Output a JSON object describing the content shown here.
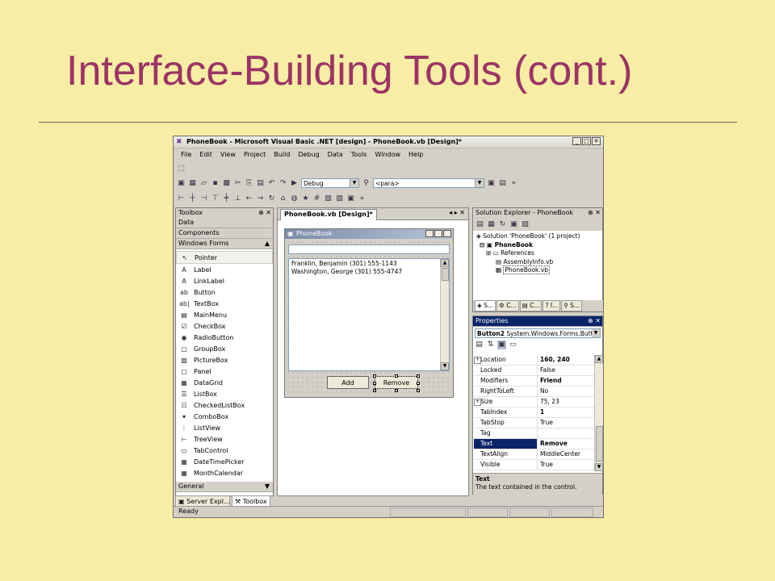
{
  "slide": {
    "title": "Interface-Building Tools (cont.)",
    "title_color": "#9b3464",
    "background": "#f7eda5"
  },
  "window": {
    "title": "PhoneBook - Microsoft Visual Basic .NET [design] - PhoneBook.vb [Design]*",
    "menu": [
      "File",
      "Edit",
      "View",
      "Project",
      "Build",
      "Debug",
      "Data",
      "Tools",
      "Window",
      "Help"
    ],
    "config_combo": "Debug",
    "find_combo": "<para>"
  },
  "toolbox": {
    "title": "Toolbox",
    "sections": [
      "Data",
      "Components",
      "Windows Forms"
    ],
    "items": [
      {
        "label": "Pointer",
        "icon": "pointer-icon",
        "glyph": "↖"
      },
      {
        "label": "Label",
        "icon": "label-icon",
        "glyph": "A"
      },
      {
        "label": "LinkLabel",
        "icon": "linklabel-icon",
        "glyph": "A"
      },
      {
        "label": "Button",
        "icon": "button-icon",
        "glyph": "ab"
      },
      {
        "label": "TextBox",
        "icon": "textbox-icon",
        "glyph": "ab|"
      },
      {
        "label": "MainMenu",
        "icon": "mainmenu-icon",
        "glyph": "▤"
      },
      {
        "label": "CheckBox",
        "icon": "checkbox-icon",
        "glyph": "☑"
      },
      {
        "label": "RadioButton",
        "icon": "radiobutton-icon",
        "glyph": "◉"
      },
      {
        "label": "GroupBox",
        "icon": "groupbox-icon",
        "glyph": "▢"
      },
      {
        "label": "PictureBox",
        "icon": "picturebox-icon",
        "glyph": "▨"
      },
      {
        "label": "Panel",
        "icon": "panel-icon",
        "glyph": "□"
      },
      {
        "label": "DataGrid",
        "icon": "datagrid-icon",
        "glyph": "▦"
      },
      {
        "label": "ListBox",
        "icon": "listbox-icon",
        "glyph": "☰"
      },
      {
        "label": "CheckedListBox",
        "icon": "checkedlistbox-icon",
        "glyph": "☷"
      },
      {
        "label": "ComboBox",
        "icon": "combobox-icon",
        "glyph": "▾"
      },
      {
        "label": "ListView",
        "icon": "listview-icon",
        "glyph": "⋮"
      },
      {
        "label": "TreeView",
        "icon": "treeview-icon",
        "glyph": "⊢"
      },
      {
        "label": "TabControl",
        "icon": "tabcontrol-icon",
        "glyph": "▭"
      },
      {
        "label": "DateTimePicker",
        "icon": "datetimepicker-icon",
        "glyph": "▦"
      },
      {
        "label": "MonthCalendar",
        "icon": "monthcalendar-icon",
        "glyph": "▦"
      }
    ],
    "footer_section": "General",
    "bottom_tabs": [
      "Server Expl...",
      "Toolbox"
    ]
  },
  "designer": {
    "tab": "PhoneBook.vb [Design]*",
    "form_title": "PhoneBook",
    "list_items": [
      "Franklin, Benjamin (301) 555-1143",
      "Washington, George (301) 555-4747"
    ],
    "add_button": "Add",
    "remove_button": "Remove"
  },
  "solution_explorer": {
    "title": "Solution Explorer - PhoneBook",
    "solution": "Solution 'PhoneBook' (1 project)",
    "project": "PhoneBook",
    "items": [
      "References",
      "AssemblyInfo.vb",
      "PhoneBook.vb"
    ],
    "tabs": [
      "S...",
      "C...",
      "C...",
      "I...",
      "S..."
    ]
  },
  "properties": {
    "title": "Properties",
    "object_name": "Button2",
    "object_type": "System.Windows.Forms.Button",
    "rows": [
      {
        "name": "Location",
        "value": "160, 240",
        "bold": true,
        "expand": true
      },
      {
        "name": "Locked",
        "value": "False"
      },
      {
        "name": "Modifiers",
        "value": "Friend",
        "bold": true
      },
      {
        "name": "RightToLeft",
        "value": "No"
      },
      {
        "name": "Size",
        "value": "75, 23",
        "expand": true
      },
      {
        "name": "TabIndex",
        "value": "1",
        "bold": true
      },
      {
        "name": "TabStop",
        "value": "True"
      },
      {
        "name": "Tag",
        "value": ""
      },
      {
        "name": "Text",
        "value": "Remove",
        "bold": true,
        "selected": true
      },
      {
        "name": "TextAlign",
        "value": "MiddleCenter"
      },
      {
        "name": "Visible",
        "value": "True"
      }
    ],
    "desc_title": "Text",
    "desc_text": "The text contained in the control."
  },
  "status": {
    "text": "Ready"
  }
}
